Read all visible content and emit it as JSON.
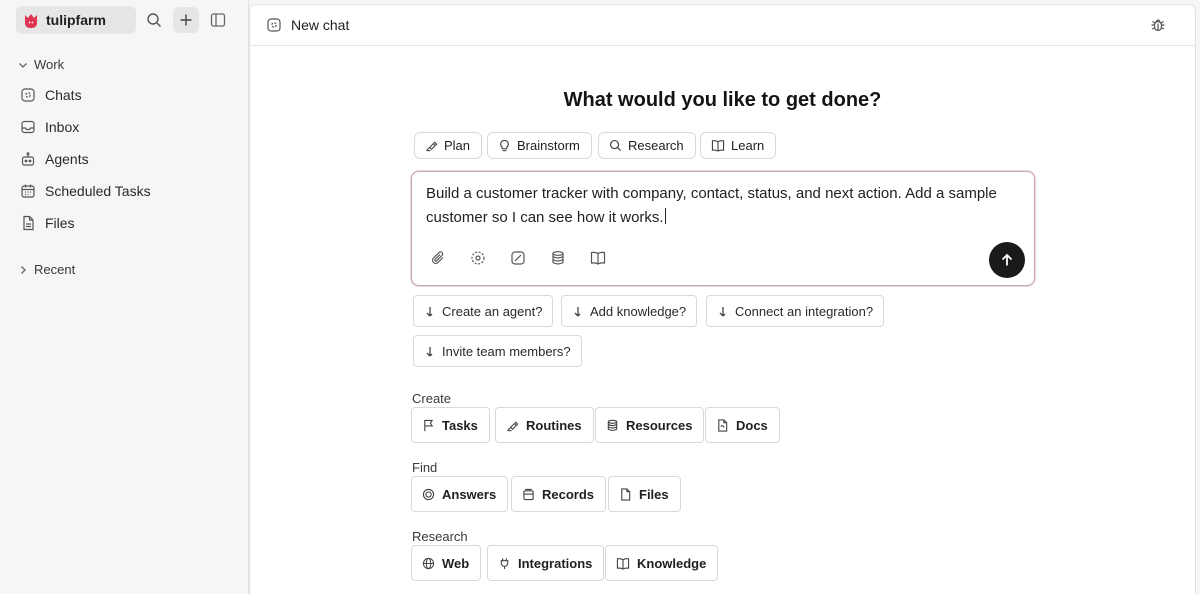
{
  "workspace": {
    "name": "tulipfarm"
  },
  "sidebar": {
    "sections": {
      "work": "Work",
      "recent": "Recent"
    },
    "items": [
      {
        "label": "Chats",
        "icon": "chat-icon"
      },
      {
        "label": "Inbox",
        "icon": "inbox-icon"
      },
      {
        "label": "Agents",
        "icon": "agent-icon"
      },
      {
        "label": "Scheduled Tasks",
        "icon": "calendar-icon"
      },
      {
        "label": "Files",
        "icon": "file-icon"
      }
    ]
  },
  "header": {
    "title": "New chat"
  },
  "main": {
    "headline": "What would you like to get done?",
    "modes": [
      {
        "label": "Plan",
        "icon": "plan-icon"
      },
      {
        "label": "Brainstorm",
        "icon": "lightbulb-icon"
      },
      {
        "label": "Research",
        "icon": "search-icon"
      },
      {
        "label": "Learn",
        "icon": "book-icon"
      }
    ],
    "composer": {
      "text": "Build a customer tracker with company, contact, status, and next action. Add a sample customer so I can see how it works."
    },
    "suggestions": [
      "Create an agent?",
      "Add knowledge?",
      "Connect an integration?",
      "Invite team members?"
    ],
    "groups": {
      "create": {
        "label": "Create",
        "items": [
          "Tasks",
          "Routines",
          "Resources",
          "Docs"
        ]
      },
      "find": {
        "label": "Find",
        "items": [
          "Answers",
          "Records",
          "Files"
        ]
      },
      "research": {
        "label": "Research",
        "items": [
          "Web",
          "Integrations",
          "Knowledge"
        ]
      }
    }
  },
  "colors": {
    "accent_border": "#c9a9b2",
    "send_button": "#1a1a1a",
    "logo": "#e0334f"
  }
}
